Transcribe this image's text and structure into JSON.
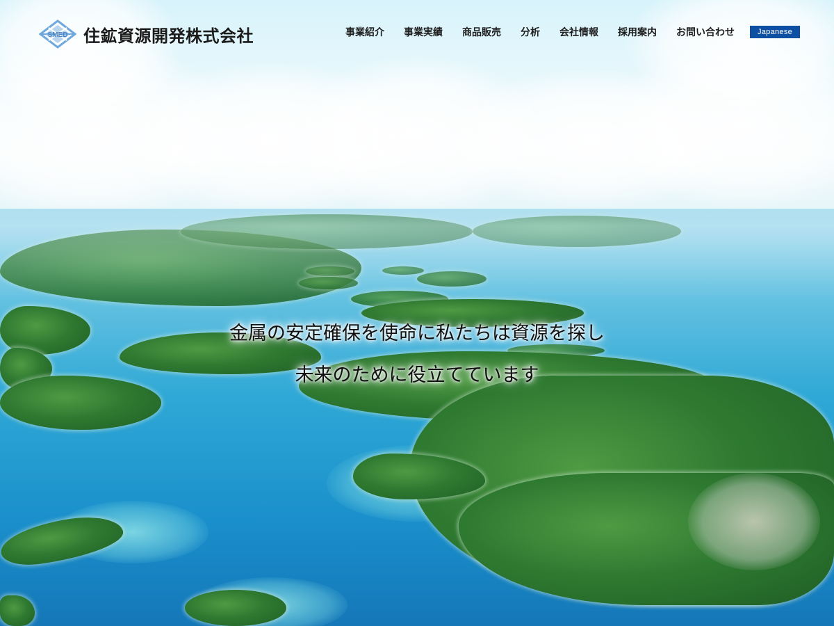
{
  "company": {
    "name": "住鉱資源開発株式会社",
    "logo_text": "SMED"
  },
  "nav": {
    "items": [
      {
        "label": "事業紹介"
      },
      {
        "label": "事業実績"
      },
      {
        "label": "商品販売"
      },
      {
        "label": "分析"
      },
      {
        "label": "会社情報"
      },
      {
        "label": "採用案内"
      },
      {
        "label": "お問い合わせ"
      }
    ],
    "language_label": "Japanese"
  },
  "hero": {
    "tagline_line1": "金属の安定確保を使命に私たちは資源を探し",
    "tagline_line2": "未来のために役立てています"
  },
  "colors": {
    "accent": "#0d4fa3",
    "logo": "#6fa8dc",
    "text": "#1e1e1e"
  }
}
